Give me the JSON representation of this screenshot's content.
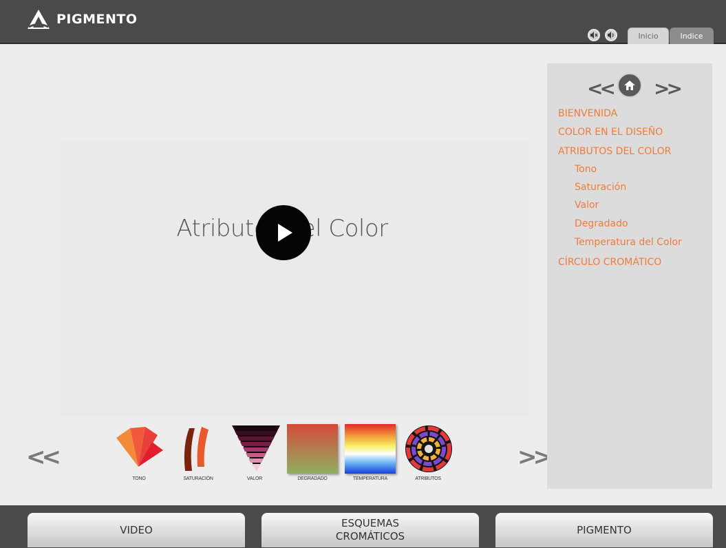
{
  "header": {
    "brand": "PIGMENTO",
    "tabs": [
      {
        "label": "Inicio",
        "active": true
      },
      {
        "label": "Indice",
        "active": false
      }
    ],
    "icons": [
      "mute-icon",
      "volume-icon"
    ]
  },
  "slide": {
    "title": "Atributos del Color"
  },
  "thumbnails": {
    "items": [
      {
        "caption": "TONO"
      },
      {
        "caption": "SATURACIÓN"
      },
      {
        "caption": "VALOR"
      },
      {
        "caption": "DEGRADADO"
      },
      {
        "caption": "TEMPERATURA"
      },
      {
        "caption": "ATRIBUTOS"
      }
    ],
    "prev_icon": "double-chevron-left-icon",
    "next_icon": "double-chevron-right-icon"
  },
  "sidebar": {
    "items": [
      {
        "label": "BIENVENIDA",
        "level": 1
      },
      {
        "label": "COLOR EN EL DISEÑO",
        "level": 1
      },
      {
        "label": "ATRIBUTOS DEL COLOR",
        "level": 1
      },
      {
        "label": "Tono",
        "level": 2
      },
      {
        "label": "Saturación",
        "level": 2
      },
      {
        "label": "Valor",
        "level": 2
      },
      {
        "label": "Degradado",
        "level": 2
      },
      {
        "label": "Temperatura del Color",
        "level": 2
      },
      {
        "label": "CÍRCULO CROMÁTICO",
        "level": 1
      }
    ],
    "link_color": "#f07a3c"
  },
  "bottom_bar": {
    "video": "VIDEO",
    "esquemas_line1": "ESQUEMAS",
    "esquemas_line2": "CROMÁTICOS",
    "pigmento": "PIGMENTO"
  },
  "colors": {
    "header_bg": "#4a4a4a",
    "sidebar_bg": "#dcdcdc",
    "accent": "#f07a3c"
  }
}
